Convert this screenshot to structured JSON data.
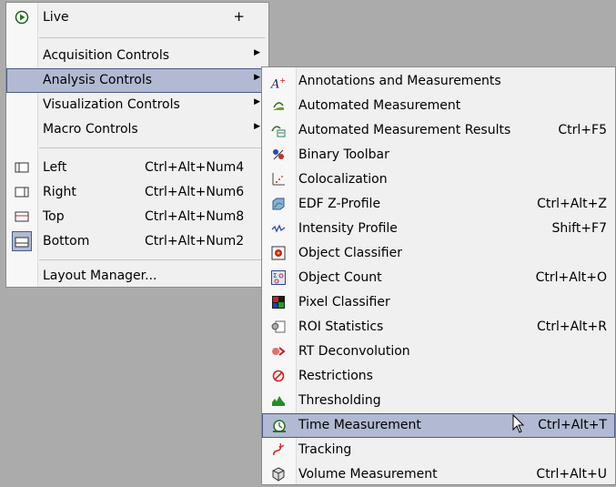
{
  "main_menu": {
    "live": {
      "label": "Live",
      "plus": "+",
      "icon": "play-circle-icon"
    },
    "items": [
      {
        "label": "Acquisition Controls"
      },
      {
        "label": "Analysis Controls"
      },
      {
        "label": "Visualization Controls"
      },
      {
        "label": "Macro Controls"
      }
    ],
    "layouts": [
      {
        "label": "Left",
        "shortcut": "Ctrl+Alt+Num4",
        "icon": "layout-left-icon"
      },
      {
        "label": "Right",
        "shortcut": "Ctrl+Alt+Num6",
        "icon": "layout-right-icon"
      },
      {
        "label": "Top",
        "shortcut": "Ctrl+Alt+Num8",
        "icon": "layout-top-icon"
      },
      {
        "label": "Bottom",
        "shortcut": "Ctrl+Alt+Num2",
        "icon": "layout-bottom-icon"
      }
    ],
    "layout_manager": "Layout Manager...",
    "highlighted": "Analysis Controls"
  },
  "sub_menu": {
    "items": [
      {
        "label": "Annotations and Measurements",
        "shortcut": "",
        "icon": "annotation-icon"
      },
      {
        "label": "Automated Measurement",
        "shortcut": "",
        "icon": "automated-measurement-icon"
      },
      {
        "label": "Automated Measurement Results",
        "shortcut": "Ctrl+F5",
        "icon": "measurement-results-icon"
      },
      {
        "label": "Binary Toolbar",
        "shortcut": "",
        "icon": "binary-toolbar-icon"
      },
      {
        "label": "Colocalization",
        "shortcut": "",
        "icon": "colocalization-icon"
      },
      {
        "label": "EDF Z-Profile",
        "shortcut": "Ctrl+Alt+Z",
        "icon": "edf-profile-icon"
      },
      {
        "label": "Intensity Profile",
        "shortcut": "Shift+F7",
        "icon": "intensity-profile-icon"
      },
      {
        "label": "Object Classifier",
        "shortcut": "",
        "icon": "object-classifier-icon"
      },
      {
        "label": "Object Count",
        "shortcut": "Ctrl+Alt+O",
        "icon": "object-count-icon"
      },
      {
        "label": "Pixel Classifier",
        "shortcut": "",
        "icon": "pixel-classifier-icon"
      },
      {
        "label": "ROI Statistics",
        "shortcut": "Ctrl+Alt+R",
        "icon": "roi-statistics-icon"
      },
      {
        "label": "RT Deconvolution",
        "shortcut": "",
        "icon": "deconvolution-icon"
      },
      {
        "label": "Restrictions",
        "shortcut": "",
        "icon": "restrictions-icon"
      },
      {
        "label": "Thresholding",
        "shortcut": "",
        "icon": "thresholding-icon"
      },
      {
        "label": "Time Measurement",
        "shortcut": "Ctrl+Alt+T",
        "icon": "clock-icon"
      },
      {
        "label": "Tracking",
        "shortcut": "",
        "icon": "tracking-icon"
      },
      {
        "label": "Volume Measurement",
        "shortcut": "Ctrl+Alt+U",
        "icon": "volume-icon"
      }
    ],
    "highlighted": "Time Measurement"
  },
  "colors": {
    "highlight_bg": "#b1bad2",
    "highlight_border": "#4a5a88",
    "desktop": "#ababab"
  }
}
